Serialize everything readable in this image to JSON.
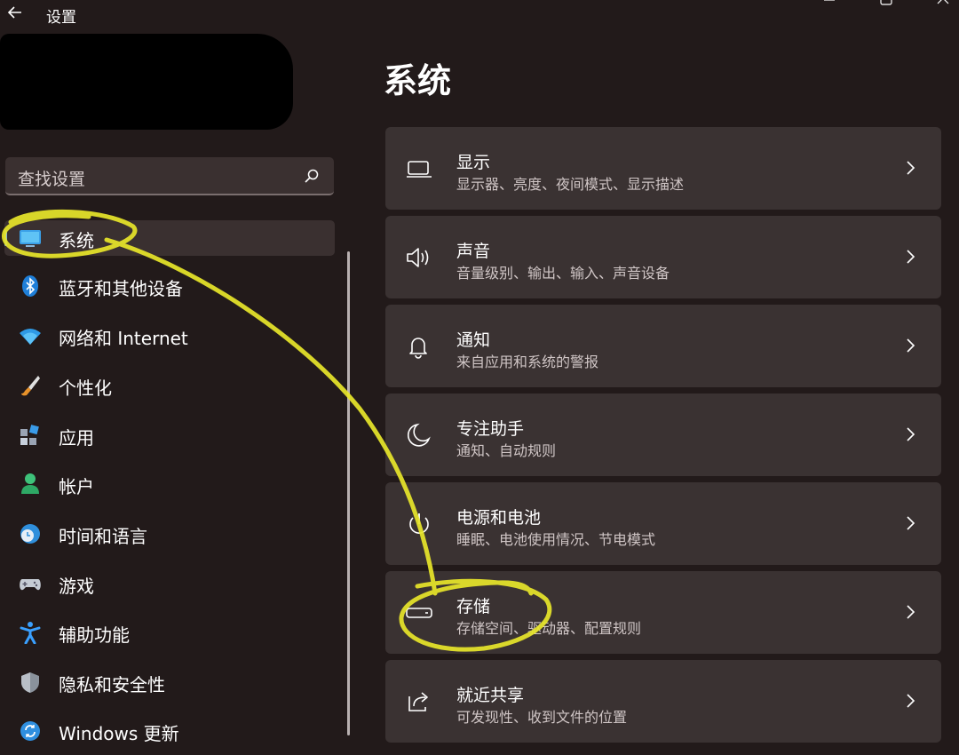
{
  "app": {
    "title": "设置"
  },
  "search": {
    "placeholder": "查找设置"
  },
  "sidebar": {
    "items": [
      {
        "label": "系统",
        "icon": "monitor-icon",
        "active": true
      },
      {
        "label": "蓝牙和其他设备",
        "icon": "bluetooth-icon"
      },
      {
        "label": "网络和 Internet",
        "icon": "wifi-icon"
      },
      {
        "label": "个性化",
        "icon": "paintbrush-icon"
      },
      {
        "label": "应用",
        "icon": "apps-icon"
      },
      {
        "label": "帐户",
        "icon": "account-icon"
      },
      {
        "label": "时间和语言",
        "icon": "globe-clock-icon"
      },
      {
        "label": "游戏",
        "icon": "gamepad-icon"
      },
      {
        "label": "辅助功能",
        "icon": "accessibility-icon"
      },
      {
        "label": "隐私和安全性",
        "icon": "shield-icon"
      },
      {
        "label": "Windows 更新",
        "icon": "windows-update-icon"
      }
    ]
  },
  "main": {
    "title": "系统",
    "cards": [
      {
        "title": "显示",
        "subtitle": "显示器、亮度、夜间模式、显示描述",
        "icon": "display-icon"
      },
      {
        "title": "声音",
        "subtitle": "音量级别、输出、输入、声音设备",
        "icon": "speaker-icon"
      },
      {
        "title": "通知",
        "subtitle": "来自应用和系统的警报",
        "icon": "bell-icon"
      },
      {
        "title": "专注助手",
        "subtitle": "通知、自动规则",
        "icon": "moon-icon"
      },
      {
        "title": "电源和电池",
        "subtitle": "睡眠、电池使用情况、节电模式",
        "icon": "power-icon"
      },
      {
        "title": "存储",
        "subtitle": "存储空间、驱动器、配置规则",
        "icon": "storage-icon"
      },
      {
        "title": "就近共享",
        "subtitle": "可发现性、收到文件的位置",
        "icon": "share-icon"
      }
    ]
  },
  "colors": {
    "background": "#221a1a",
    "card": "#3a3232",
    "accent": "#7fb2e6",
    "annotation": "#e8e62a"
  }
}
